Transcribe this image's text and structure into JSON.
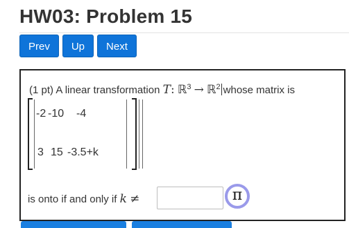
{
  "page": {
    "title": "HW03: Problem 15"
  },
  "nav": {
    "prev_label": "Prev",
    "up_label": "Up",
    "next_label": "Next"
  },
  "problem": {
    "points": "(1 pt)",
    "text_intro": "A linear transformation",
    "math_T": "T",
    "math_colon": ":",
    "math_R": "ℝ",
    "math_exp3": "3",
    "math_arrow": "→",
    "math_exp2": "2",
    "text_after": "whose matrix is",
    "matrix": [
      [
        "-2",
        "-10",
        "-4"
      ],
      [
        "3",
        "15",
        "-3.5+k"
      ]
    ],
    "onto_text": "is onto if and only if",
    "math_k": "k",
    "math_neq": "≠",
    "answer_value": ""
  },
  "buttons": {
    "pi_symbol": "π"
  },
  "colors": {
    "button_blue": "#0f74d9",
    "pi_ring": "#9a9aea"
  }
}
